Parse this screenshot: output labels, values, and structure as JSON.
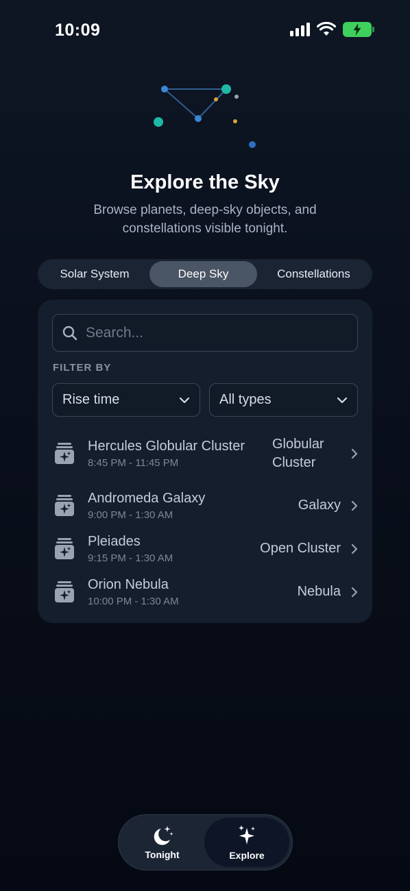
{
  "status_bar": {
    "time": "10:09"
  },
  "hero": {
    "title": "Explore the Sky",
    "subtitle": "Browse planets, deep-sky objects, and constellations visible tonight."
  },
  "segments": [
    {
      "label": "Solar System",
      "active": false
    },
    {
      "label": "Deep Sky",
      "active": true
    },
    {
      "label": "Constellations",
      "active": false
    }
  ],
  "search": {
    "placeholder": "Search..."
  },
  "filters": {
    "label": "FILTER BY",
    "sort_value": "Rise time",
    "type_value": "All types"
  },
  "objects": [
    {
      "name": "Hercules Globular Cluster",
      "time": "8:45 PM - 11:45 PM",
      "type": "Globular Cluster",
      "icon": "deep-sky-icon"
    },
    {
      "name": "Andromeda Galaxy",
      "time": "9:00 PM - 1:30 AM",
      "type": "Galaxy",
      "icon": "deep-sky-icon"
    },
    {
      "name": "Pleiades",
      "time": "9:15 PM - 1:30 AM",
      "type": "Open Cluster",
      "icon": "deep-sky-icon"
    },
    {
      "name": "Orion Nebula",
      "time": "10:00 PM - 1:30 AM",
      "type": "Nebula",
      "icon": "deep-sky-icon"
    }
  ],
  "tabbar": {
    "tabs": [
      {
        "label": "Tonight",
        "icon": "moon-stars-icon",
        "active": false
      },
      {
        "label": "Explore",
        "icon": "sparkles-icon",
        "active": true
      }
    ]
  },
  "colors": {
    "background": "#0a101c",
    "card": "#141e2d",
    "segment_active": "#4a5565",
    "battery": "#3ecf5c",
    "accent_teal": "#1fb8a6",
    "accent_blue": "#3a86d6",
    "accent_gold": "#d9a33a"
  }
}
